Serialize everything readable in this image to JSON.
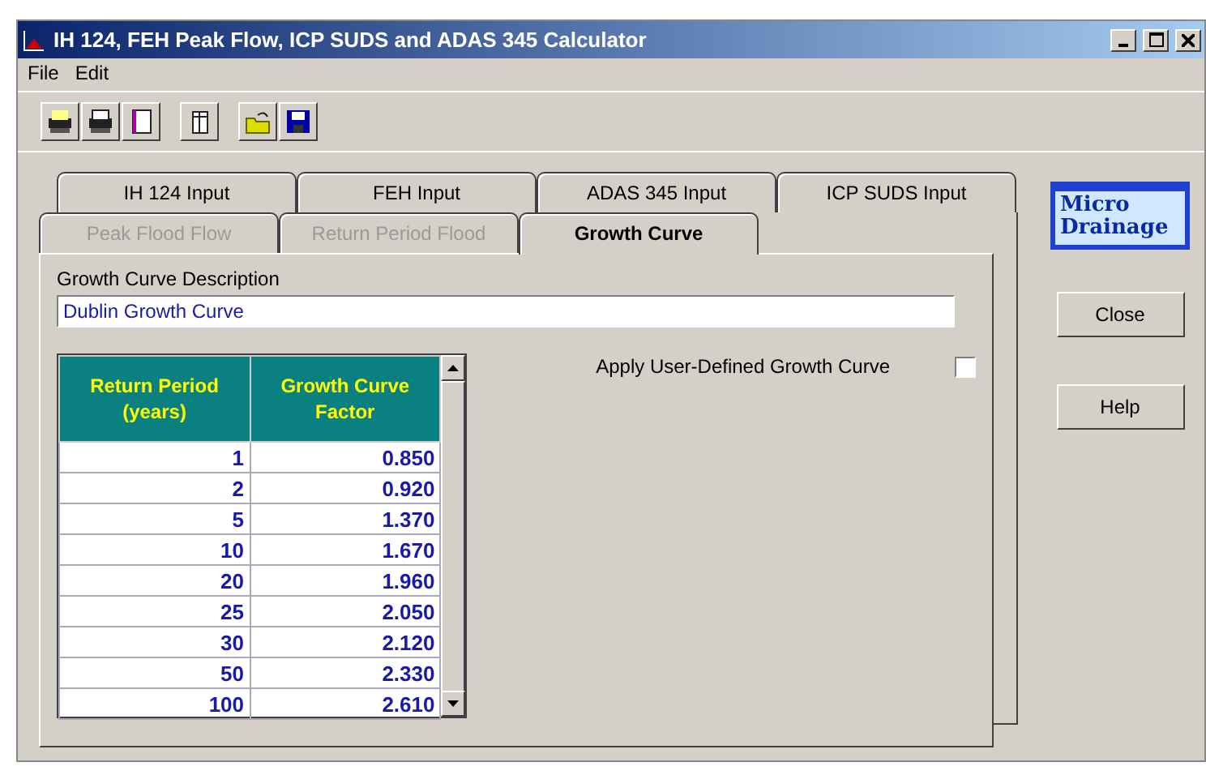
{
  "window": {
    "title": "IH 124, FEH Peak Flow, ICP SUDS and ADAS 345 Calculator"
  },
  "menu": [
    "File",
    "Edit"
  ],
  "tab_rows": [
    [
      {
        "label": "IH 124 Input",
        "selected": false,
        "disabled": false
      },
      {
        "label": "FEH Input",
        "selected": false,
        "disabled": false
      },
      {
        "label": "ADAS 345 Input",
        "selected": false,
        "disabled": false
      },
      {
        "label": "ICP SUDS Input",
        "selected": false,
        "disabled": false
      }
    ],
    [
      {
        "label": "Peak Flood Flow",
        "selected": false,
        "disabled": true
      },
      {
        "label": "Return Period Flood",
        "selected": false,
        "disabled": true
      },
      {
        "label": "Growth Curve",
        "selected": true,
        "disabled": false
      }
    ]
  ],
  "description": {
    "label": "Growth Curve Description",
    "value": "Dublin Growth Curve"
  },
  "table": {
    "columns": [
      "Return Period (years)",
      "Growth Curve Factor"
    ],
    "rows": [
      [
        "1",
        "0.850"
      ],
      [
        "2",
        "0.920"
      ],
      [
        "5",
        "1.370"
      ],
      [
        "10",
        "1.670"
      ],
      [
        "20",
        "1.960"
      ],
      [
        "25",
        "2.050"
      ],
      [
        "30",
        "2.120"
      ],
      [
        "50",
        "2.330"
      ],
      [
        "100",
        "2.610"
      ]
    ]
  },
  "apply_user_defined": {
    "label": "Apply User-Defined Growth Curve",
    "checked": false
  },
  "logo": [
    "Micro",
    "Drainage"
  ],
  "buttons": [
    "Close",
    "Help"
  ]
}
